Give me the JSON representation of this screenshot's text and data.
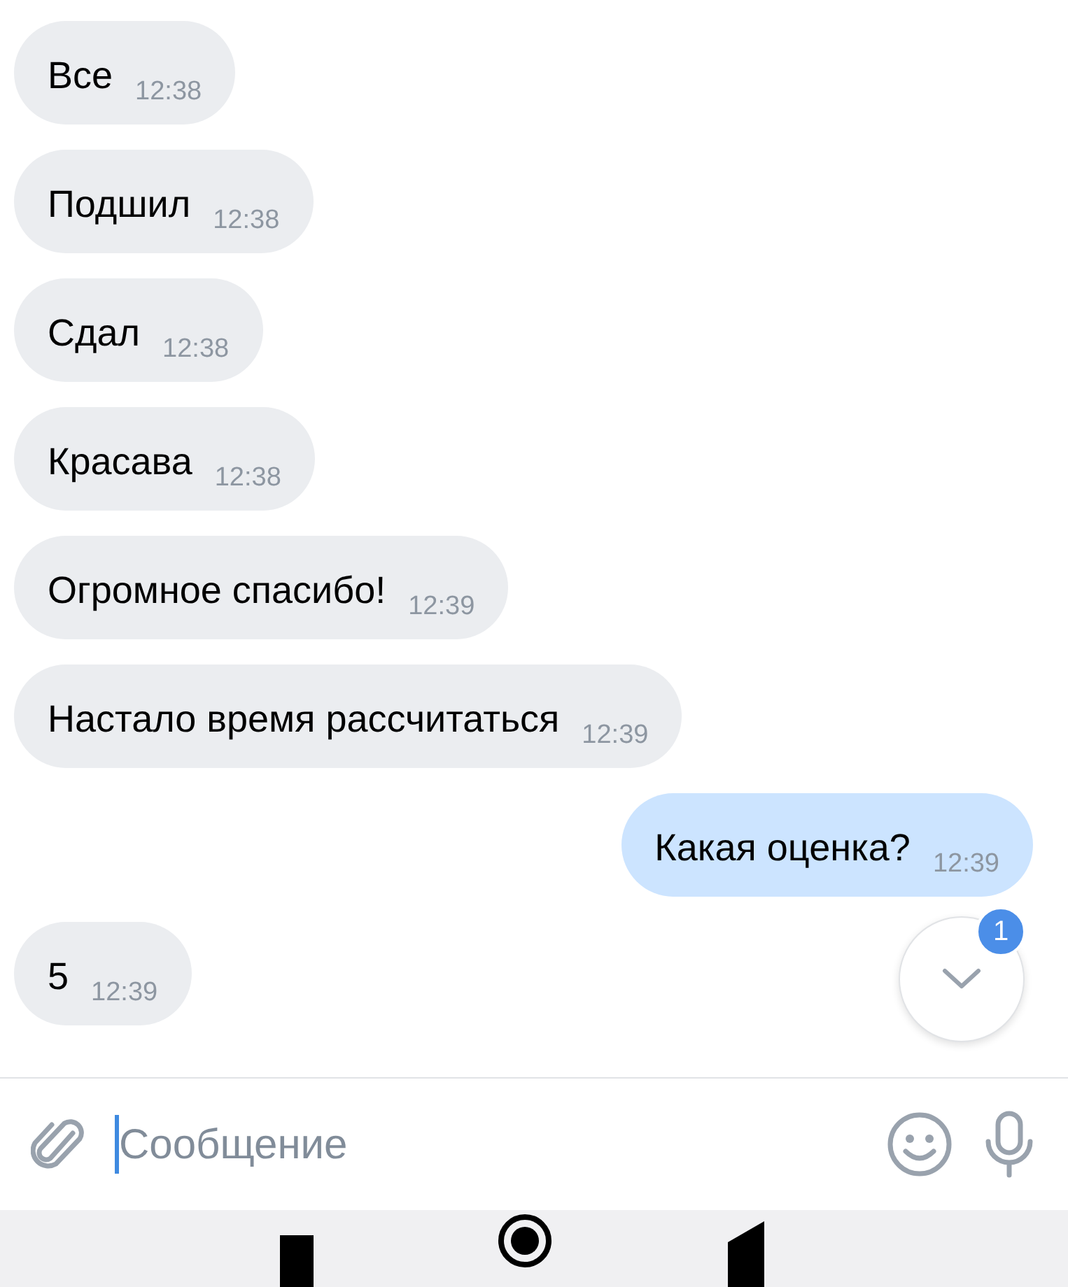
{
  "messages": [
    {
      "text": "Все",
      "time": "12:38",
      "outgoing": false
    },
    {
      "text": "Подшил",
      "time": "12:38",
      "outgoing": false
    },
    {
      "text": "Сдал",
      "time": "12:38",
      "outgoing": false
    },
    {
      "text": "Красава",
      "time": "12:38",
      "outgoing": false
    },
    {
      "text": "Огромное спасибо!",
      "time": "12:39",
      "outgoing": false
    },
    {
      "text": "Настало время рассчитаться",
      "time": "12:39",
      "outgoing": false
    },
    {
      "text": "Какая оценка?",
      "time": "12:39",
      "outgoing": true
    },
    {
      "text": "5",
      "time": "12:39",
      "outgoing": false
    }
  ],
  "scroll_down_button": {
    "badge": "1"
  },
  "composer": {
    "placeholder": "Сообщение"
  }
}
